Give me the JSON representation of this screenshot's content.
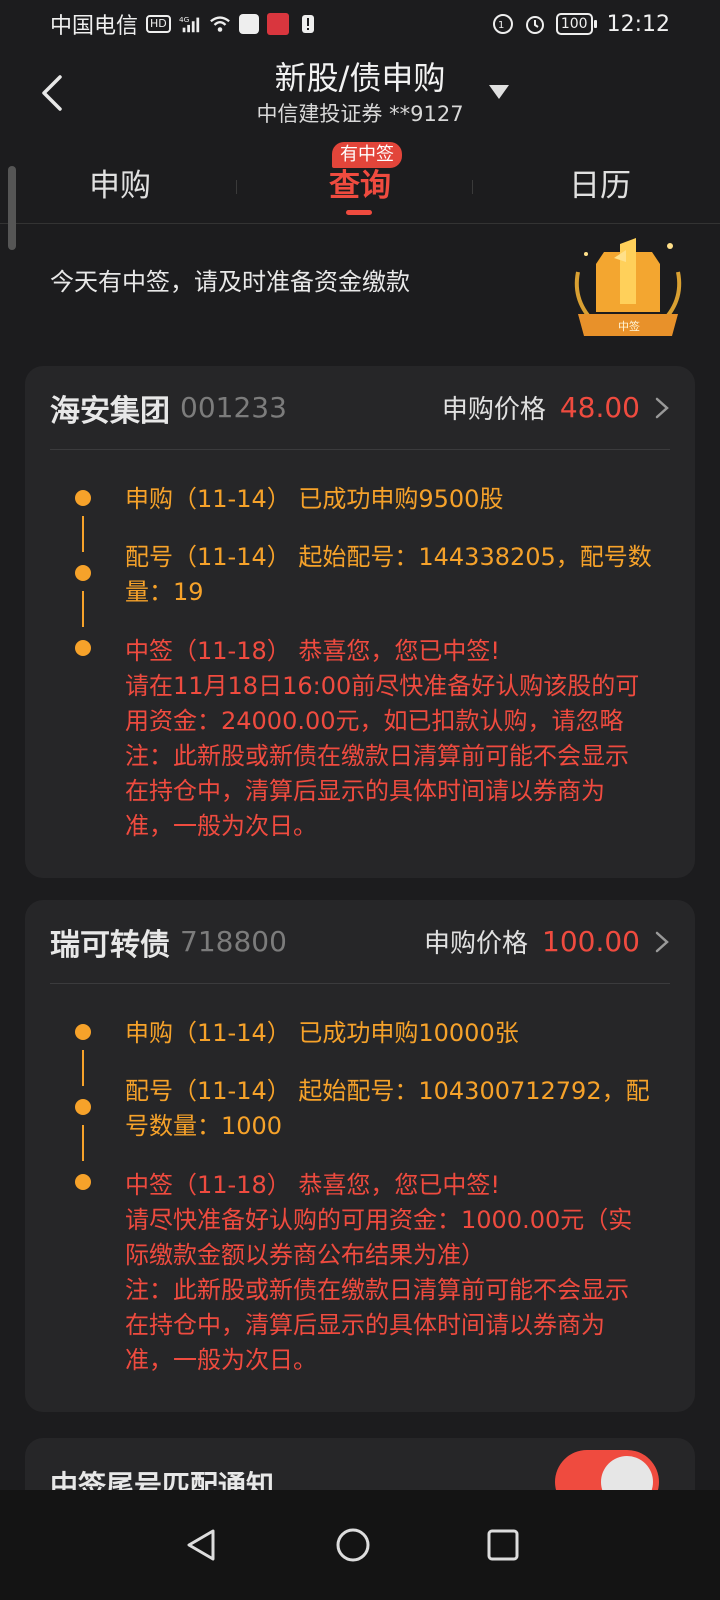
{
  "status_bar": {
    "carrier": "中国电信",
    "hd": "HD",
    "network": "4G",
    "battery": "100",
    "time": "12:12"
  },
  "header": {
    "title": "新股/债申购",
    "subtitle": "中信建投证券 **9127"
  },
  "tabs": [
    {
      "label": "申购"
    },
    {
      "label": "查询",
      "badge": "有中签"
    },
    {
      "label": "日历"
    }
  ],
  "notice": "今天有中签，请及时准备资金缴款",
  "trophy_label": "中签",
  "cards": [
    {
      "name": "海安集团",
      "code": "001233",
      "price_label": "申购价格",
      "price": "48.00",
      "entries": [
        {
          "lines": [
            "申购（11-14） 已成功申购9500股"
          ]
        },
        {
          "lines": [
            "配号（11-14） 起始配号：144338205，配号数",
            "量：19"
          ]
        },
        {
          "lines": [
            "中签（11-18） 恭喜您，您已中签!",
            "请在11月18日16:00前尽快准备好认购该股的可",
            "用资金：24000.00元，如已扣款认购，请忽略",
            "注：此新股或新债在缴款日清算前可能不会显示",
            "在持仓中，清算后显示的具体时间请以券商为",
            "准，一般为次日。"
          ]
        }
      ]
    },
    {
      "name": "瑞可转债",
      "code": "718800",
      "price_label": "申购价格",
      "price": "100.00",
      "entries": [
        {
          "lines": [
            "申购（11-14） 已成功申购10000张"
          ]
        },
        {
          "lines": [
            "配号（11-14） 起始配号：104300712792，配",
            "号数量：1000"
          ]
        },
        {
          "lines": [
            "中签（11-18） 恭喜您，您已中签!",
            "请尽快准备好认购的可用资金：1000.00元（实",
            "际缴款金额以券商公布结果为准）",
            "注：此新股或新债在缴款日清算前可能不会显示",
            "在持仓中，清算后显示的具体时间请以券商为",
            "准，一般为次日。"
          ]
        }
      ]
    }
  ],
  "bottom_card": {
    "title": "中签尾号匹配通知",
    "toggle_on": true
  },
  "colors": {
    "accent_red": "#ef4b3f",
    "accent_orange": "#f6a22a",
    "background": "#1c1c1e",
    "card": "#262628"
  }
}
